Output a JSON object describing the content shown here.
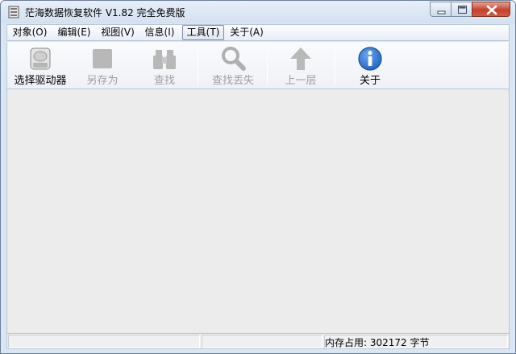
{
  "window": {
    "title": "茫海数据恢复软件 V1.82 完全免费版"
  },
  "menu": [
    {
      "label": "对象(O)"
    },
    {
      "label": "编辑(E)"
    },
    {
      "label": "视图(V)"
    },
    {
      "label": "信息(I)"
    },
    {
      "label": "工具(T)"
    },
    {
      "label": "关于(A)"
    }
  ],
  "toolbar": [
    {
      "label": "选择驱动器",
      "icon": "drive-icon",
      "enabled": true
    },
    {
      "label": "另存为",
      "icon": "save-icon",
      "enabled": false
    },
    {
      "label": "查找",
      "icon": "binoculars-icon",
      "enabled": false
    },
    {
      "label": "查找丢失",
      "icon": "magnifier-icon",
      "enabled": false
    },
    {
      "label": "上一层",
      "icon": "up-arrow-icon",
      "enabled": false
    },
    {
      "label": "关于",
      "icon": "info-icon",
      "enabled": true
    }
  ],
  "status": {
    "memory": "内存占用: 302172 字节"
  },
  "colors": {
    "info_blue": "#1f63c6",
    "close_red": "#c4412b",
    "disabled_gray": "#a0a0a0"
  }
}
